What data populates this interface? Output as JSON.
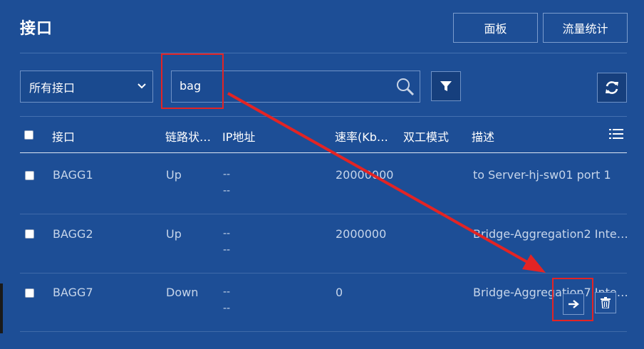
{
  "page": {
    "title": "接口"
  },
  "toolbar": {
    "panel_label": "面板",
    "traffic_label": "流量统计"
  },
  "filter": {
    "selected": "所有接口"
  },
  "search": {
    "value": "bag"
  },
  "table": {
    "headers": {
      "interface": "接口",
      "link_state": "链路状…",
      "ip": "IP地址",
      "speed": "速率(Kb…",
      "duplex": "双工模式",
      "description": "描述"
    },
    "rows": [
      {
        "interface": "BAGG1",
        "link_state": "Up",
        "ip1": "--",
        "ip2": "--",
        "speed": "20000000",
        "description": "to Server-hj-sw01 port 1"
      },
      {
        "interface": "BAGG2",
        "link_state": "Up",
        "ip1": "--",
        "ip2": "--",
        "speed": "2000000",
        "description": "Bridge-Aggregation2 Inte…"
      },
      {
        "interface": "BAGG7",
        "link_state": "Down",
        "ip1": "--",
        "ip2": "--",
        "speed": "0",
        "description": "Bridge-Aggregation7 Inte…"
      }
    ]
  },
  "icons": {
    "search": "search-icon",
    "filter": "filter-icon",
    "refresh": "refresh-icon",
    "columns": "column-settings-icon",
    "go": "arrow-right-icon",
    "delete": "trash-icon"
  },
  "colors": {
    "background": "#1d4e96",
    "annotation": "#e32424"
  }
}
